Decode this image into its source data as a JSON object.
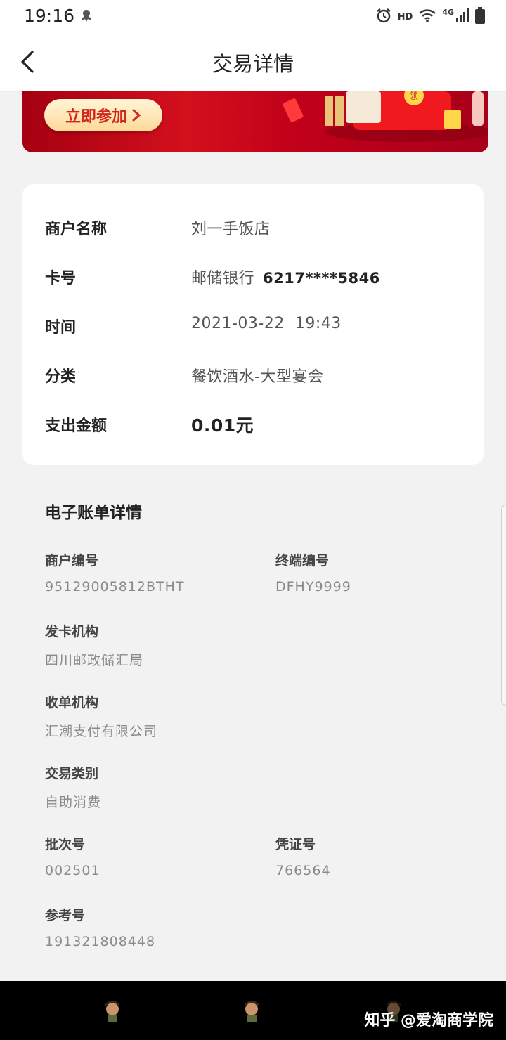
{
  "status_bar": {
    "time": "19:16",
    "hd": "HD",
    "network": "4G",
    "icons": [
      "alien-icon",
      "alarm-icon",
      "wifi-icon",
      "signal-icon",
      "battery-icon"
    ]
  },
  "header": {
    "title": "交易详情",
    "back_icon": "chevron-left-icon"
  },
  "banner": {
    "button_label": "立即参加",
    "envelope_text": "领",
    "colors": {
      "bg": "#c80f1c",
      "button": "#ffe2a8",
      "button_text": "#d2281c"
    }
  },
  "transaction": {
    "merchant_label": "商户名称",
    "merchant_value": "刘一手饭店",
    "card_label": "卡号",
    "bank_name": "邮储银行",
    "card_number": "6217****5846",
    "time_label": "时间",
    "time_value": "2021-03-22  19:43",
    "category_label": "分类",
    "category_value": "餐饮酒水-大型宴会",
    "amount_label": "支出金额",
    "amount_value": "0.01元"
  },
  "e_bill": {
    "title": "电子账单详情",
    "merchant_no_label": "商户编号",
    "merchant_no_value": "95129005812BTHT",
    "terminal_no_label": "终端编号",
    "terminal_no_value": "DFHY9999",
    "issuer_label": "发卡机构",
    "issuer_value": "四川邮政储汇局",
    "acquirer_label": "收单机构",
    "acquirer_value": "汇潮支付有限公司",
    "txn_type_label": "交易类别",
    "txn_type_value": "自助消费",
    "batch_no_label": "批次号",
    "batch_no_value": "002501",
    "voucher_no_label": "凭证号",
    "voucher_no_value": "766564",
    "reference_no_label": "参考号",
    "reference_no_value": "191321808448"
  },
  "watermark": "知乎 @爱淘商学院"
}
